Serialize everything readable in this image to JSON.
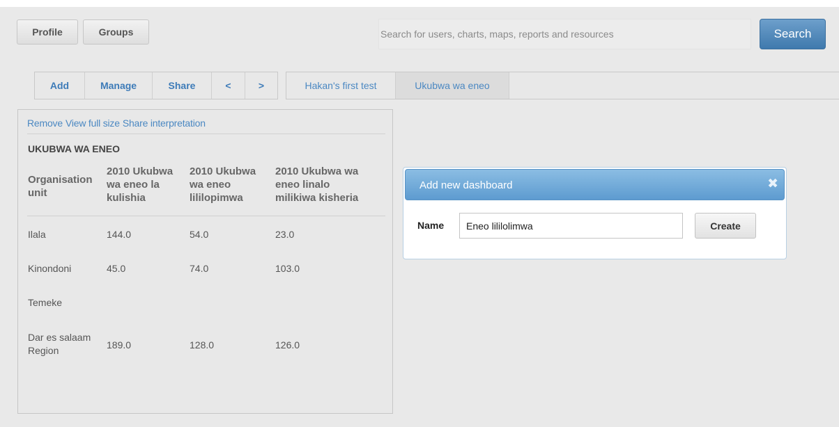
{
  "header": {
    "profile_label": "Profile",
    "groups_label": "Groups",
    "search_placeholder": "Search for users, charts, maps, reports and resources",
    "search_button": "Search"
  },
  "toolbar": {
    "items": [
      "Add",
      "Manage",
      "Share",
      "<",
      ">"
    ]
  },
  "tabs": [
    {
      "label": "Hakan's first test",
      "active": false
    },
    {
      "label": "Ukubwa wa eneo",
      "active": true
    }
  ],
  "panel": {
    "links": [
      "Remove",
      "View full size",
      "Share interpretation"
    ],
    "table_title": "UKUBWA WA ENEO",
    "columns": [
      [
        "Organisation",
        "unit"
      ],
      [
        "2010 Ukubwa",
        "wa eneo la",
        "kulishia"
      ],
      [
        "2010 Ukubwa",
        "wa eneo",
        "lililopimwa"
      ],
      [
        "2010 Ukubwa wa",
        "eneo linalo",
        "milikiwa kisheria"
      ]
    ],
    "rows": [
      {
        "unit": [
          "Ilala"
        ],
        "values": [
          "144.0",
          "54.0",
          "23.0"
        ]
      },
      {
        "unit": [
          "Kinondoni"
        ],
        "values": [
          "45.0",
          "74.0",
          "103.0"
        ]
      },
      {
        "unit": [
          "Temeke"
        ],
        "values": [
          "",
          "",
          ""
        ]
      },
      {
        "unit": [
          "Dar es salaam",
          "Region"
        ],
        "values": [
          "189.0",
          "128.0",
          "126.0"
        ]
      }
    ]
  },
  "dialog": {
    "title": "Add new dashboard",
    "close_icon": "close-icon",
    "name_label": "Name",
    "name_value": "Eneo lililolimwa",
    "create_label": "Create"
  },
  "colors": {
    "link": "#4b88c2",
    "dialog_header": "#6aa5d6",
    "search_button": "#4f87b9"
  }
}
